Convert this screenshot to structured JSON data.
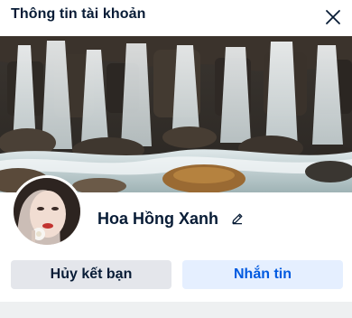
{
  "dialog": {
    "title": "Thông tin tài khoản",
    "close_icon": "close-icon"
  },
  "profile": {
    "name": "Hoa Hồng Xanh",
    "edit_icon": "pencil-icon",
    "cover_image": "waterfall-photo",
    "avatar_image": "profile-photo"
  },
  "actions": {
    "unfriend_label": "Hủy kết bạn",
    "message_label": "Nhắn tin"
  },
  "colors": {
    "primary_text": "#081c36",
    "secondary_button_bg": "#e4e6eb",
    "primary_button_bg": "#e5efff",
    "primary_button_text": "#005ae0"
  }
}
